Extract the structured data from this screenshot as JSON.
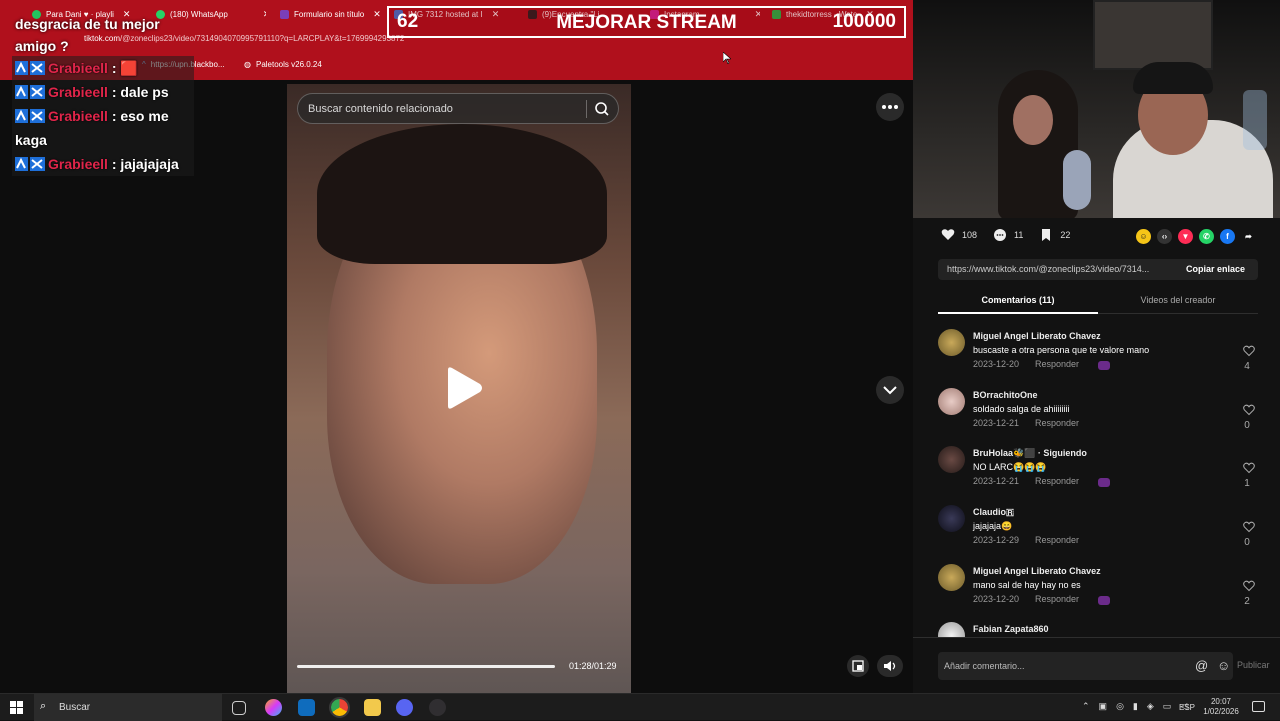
{
  "browser": {
    "tabs": [
      {
        "label": "Para Dani ♥ · playli",
        "color": "#23c55e"
      },
      {
        "label": "(180) WhatsApp",
        "color": "#25d366"
      },
      {
        "label": "Formulario sin título",
        "color": "#7b3fb8"
      },
      {
        "label": "IMG 7312 hosted at I",
        "color": "#3b7bd8"
      },
      {
        "label": "(9)Encuentra \"Li",
        "color": "#222"
      },
      {
        "label": "Instagram",
        "color": "#d6249f"
      },
      {
        "label": "thekidtorress - Wate",
        "color": "#1dbf4a"
      }
    ],
    "address_domain": "tiktok.com",
    "address_path": "/@zoneclips23/video/7314904070995791110?q=LARCPLAY&t=1769994293872",
    "bookmarks": [
      {
        "label": "https://upn.blackbo..."
      },
      {
        "label": "Paletools v26.0.24"
      }
    ]
  },
  "stream_overlay": {
    "left_number": "62",
    "title": "MEJORAR STREAM",
    "goal": "100000"
  },
  "chat": {
    "header_line1": "desgracia de tu mejor",
    "header_line2": "amigo ?",
    "messages": [
      {
        "user": "Grabieell",
        "text": ": 🟥"
      },
      {
        "user": "Grabieell",
        "text": ": dale ps"
      },
      {
        "user": "Grabieell",
        "text": ": eso me kaga"
      },
      {
        "user": "Grabieell",
        "text": ": jajajajaja"
      }
    ]
  },
  "video": {
    "search_placeholder": "Buscar contenido relacionado",
    "time": "01:28/01:29",
    "progress": 0.99
  },
  "actions": {
    "likes": "108",
    "comments": "11",
    "saves": "22"
  },
  "share": {
    "link": "https://www.tiktok.com/@zoneclips23/video/7314...",
    "copy_label": "Copiar enlace"
  },
  "tabs": {
    "comments_label": "Comentarios (11)",
    "creator_label": "Videos del creador"
  },
  "comments": [
    {
      "name": "Miguel Angel Liberato Chavez",
      "text": "buscaste a otra persona que te valore mano",
      "date": "2023-12-20",
      "reply": "Responder",
      "likes": "4",
      "avatar": "#8a7a3a"
    },
    {
      "name": "BOrrachitoOne",
      "text": "soldado salga de ahiiiiiiii",
      "date": "2023-12-21",
      "reply": "Responder",
      "likes": "0",
      "avatar": "#c9a7a0"
    },
    {
      "name": "BruHolaa🐝⬛ · Siguiendo",
      "text": "NO LARC😭😭😭",
      "date": "2023-12-21",
      "reply": "Responder",
      "likes": "1",
      "avatar": "#3a2a28"
    },
    {
      "name": "Claudio🇷",
      "text": "jajajaja😄",
      "date": "2023-12-29",
      "reply": "Responder",
      "likes": "0",
      "avatar": "#1a1a28"
    },
    {
      "name": "Miguel Angel Liberato Chavez",
      "text": "mano sal de hay hay no es",
      "date": "2023-12-20",
      "reply": "Responder",
      "likes": "2",
      "avatar": "#8a7a3a"
    },
    {
      "name": "Fabian Zapata860",
      "text": "",
      "date": "",
      "reply": "",
      "likes": "",
      "avatar": "#ddd"
    }
  ],
  "comment_input": {
    "placeholder": "Añadir comentario...",
    "publish_label": "Publicar"
  },
  "taskbar": {
    "search_label": "Buscar",
    "lang": "ESP",
    "time": "20:07",
    "date": "1/02/2026"
  }
}
